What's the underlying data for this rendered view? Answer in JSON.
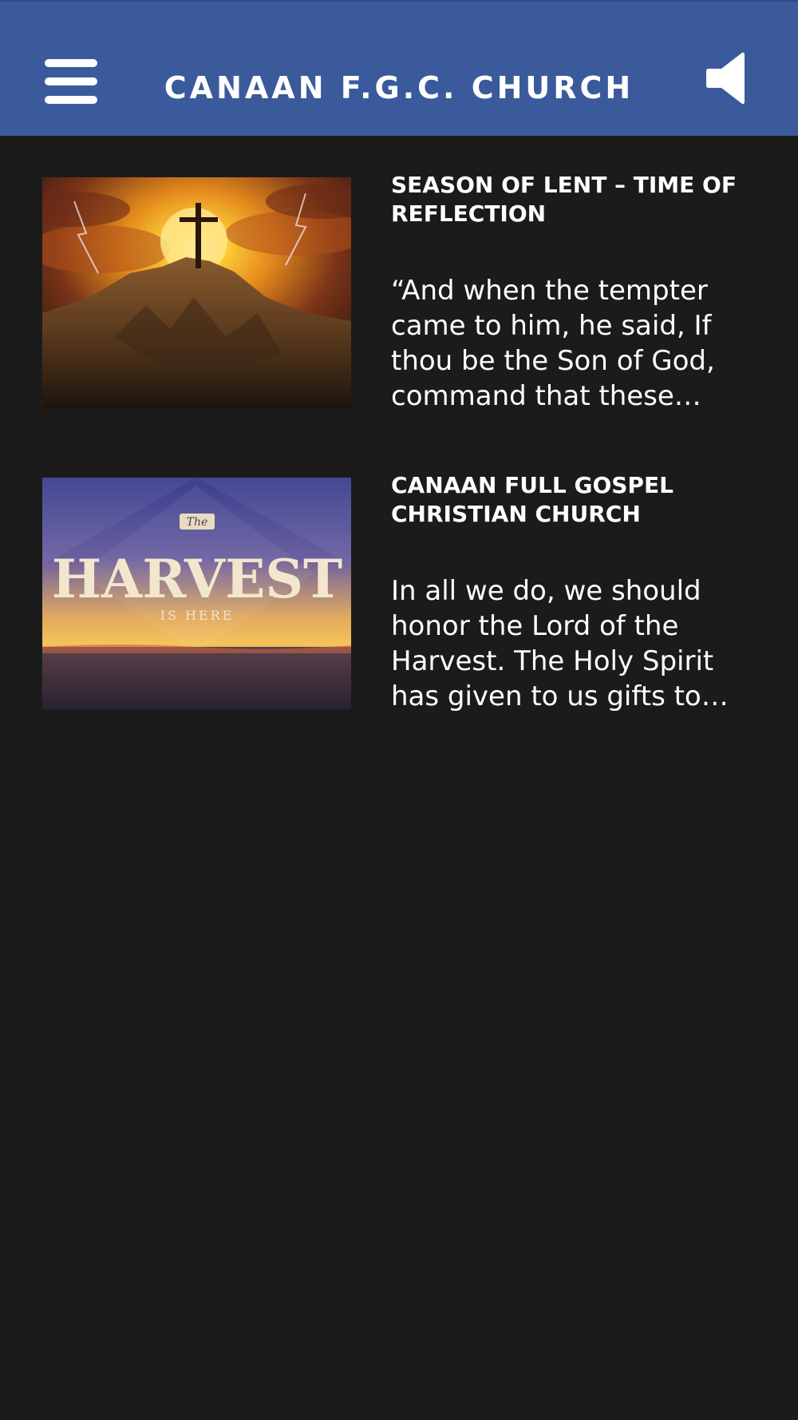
{
  "appbar": {
    "title": "CANAAN F.G.C. CHURCH",
    "menu_icon": "hamburger-menu-icon",
    "sound_icon": "speaker-icon"
  },
  "colors": {
    "appbar_bg": "#3a5a9b",
    "page_bg": "#1b1b1b",
    "text": "#ffffff"
  },
  "posts": [
    {
      "title": "SEASON OF LENT – TIME OF REFLECTION",
      "excerpt": "“And when the tempter came to him, he said, If thou be the Son of God, command that these…",
      "image": "cross-on-mountain-sunset-image"
    },
    {
      "title": "CANAAN FULL GOSPEL CHRISTIAN CHURCH",
      "excerpt": "In all we do, we should honor the Lord of the Harvest. The Holy Spirit has given to us gifts to…",
      "image": "harvest-is-here-banner-image",
      "image_text": {
        "the": "The",
        "harvest": "HARVEST",
        "is_here": "IS HERE"
      }
    }
  ]
}
